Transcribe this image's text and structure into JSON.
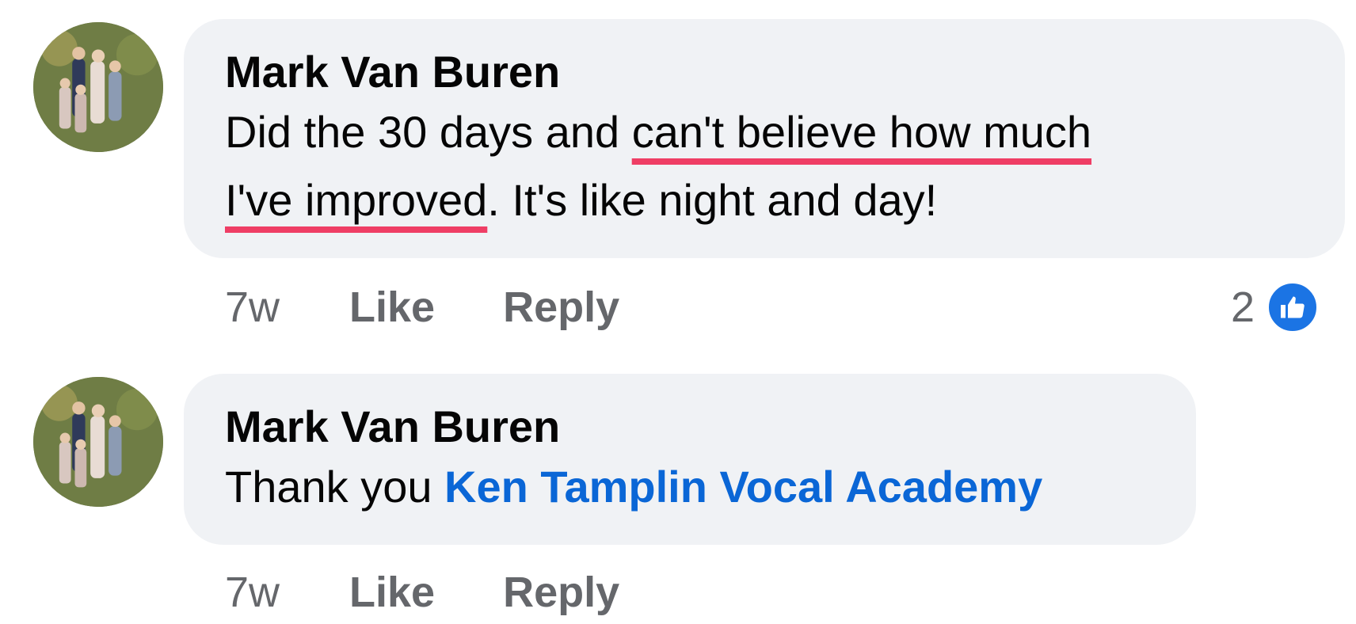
{
  "comments": [
    {
      "author": "Mark Van Buren",
      "text_before": "Did the 30 days and ",
      "text_highlight_1": "can't believe how much",
      "text_highlight_2": "I've improved",
      "text_after": ". It's like night and day!",
      "time": "7w",
      "like_label": "Like",
      "reply_label": "Reply",
      "reaction_count": "2",
      "reaction_icon": "thumbs-up-icon"
    },
    {
      "author": "Mark Van Buren",
      "text_before": "Thank you ",
      "mention": "Ken Tamplin Vocal Academy",
      "time": "7w",
      "like_label": "Like",
      "reply_label": "Reply"
    }
  ],
  "colors": {
    "bubble_bg": "#f0f2f5",
    "mention": "#0a66d6",
    "highlight_underline": "#ef3e65",
    "like_badge": "#1b74e4",
    "meta_text": "#65676b"
  }
}
